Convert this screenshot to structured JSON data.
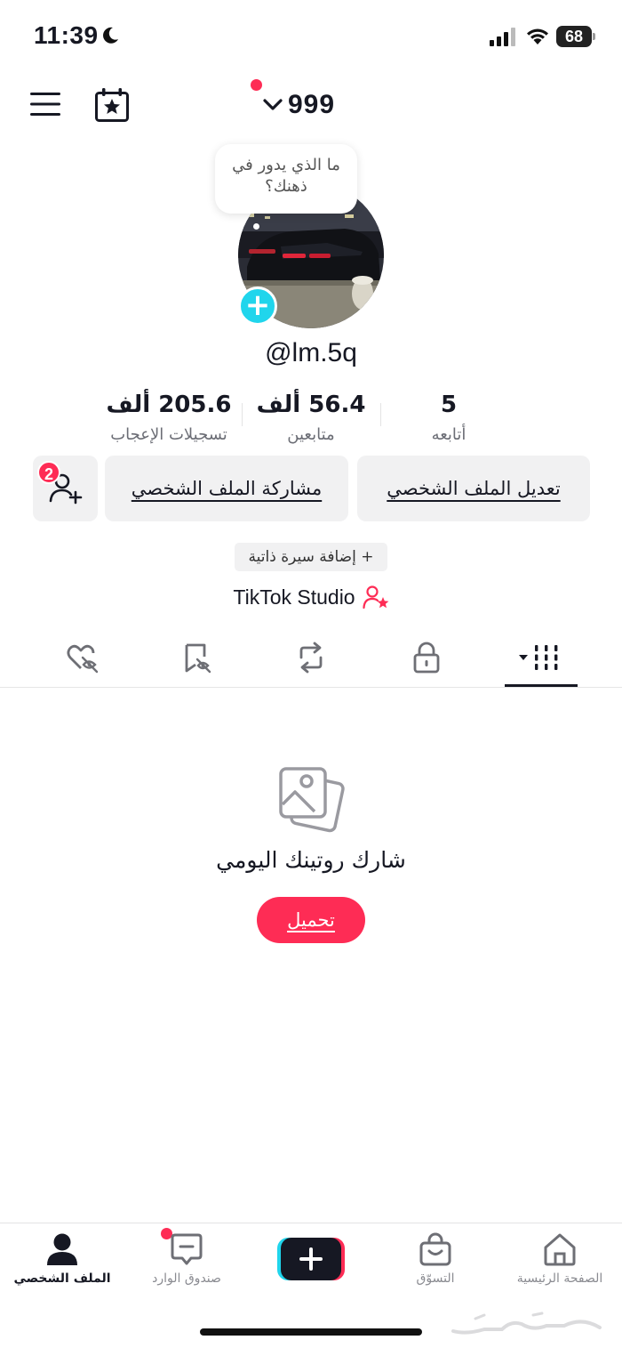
{
  "status_bar": {
    "time": "11:39",
    "battery": "68"
  },
  "header": {
    "account_name": "999"
  },
  "profile": {
    "bubble_text": "ما الذي يدور في ذهنك؟",
    "username": "@lm.5q"
  },
  "stats": {
    "following": {
      "value": "5",
      "label": "أتابعه"
    },
    "followers": {
      "value": "56.4 ألف",
      "label": "متابعين"
    },
    "likes": {
      "value": "205.6 ألف",
      "label": "تسجيلات الإعجاب"
    }
  },
  "actions": {
    "edit_label": "تعديل الملف الشخصي",
    "share_label": "مشاركة الملف الشخصي",
    "friend_requests": "2"
  },
  "bio_button": "+ إضافة سيرة ذاتية",
  "studio_label": "TikTok Studio",
  "tabs": [
    {
      "icon": "grid-icon",
      "active": true
    },
    {
      "icon": "lock-icon",
      "active": false
    },
    {
      "icon": "repost-icon",
      "active": false
    },
    {
      "icon": "favorites-icon",
      "active": false
    },
    {
      "icon": "liked-icon",
      "active": false
    }
  ],
  "empty_state": {
    "icon": "photos-icon",
    "title": "شارك روتينك اليومي",
    "button": "تحميل"
  },
  "bottom_nav": {
    "home": "الصفحة الرئيسية",
    "shop": "التسوّق",
    "inbox": "صندوق الوارد",
    "profile": "الملف الشخصي"
  },
  "colors": {
    "accent": "#fe2c55",
    "cyan": "#20d5ec",
    "text": "#161823"
  }
}
